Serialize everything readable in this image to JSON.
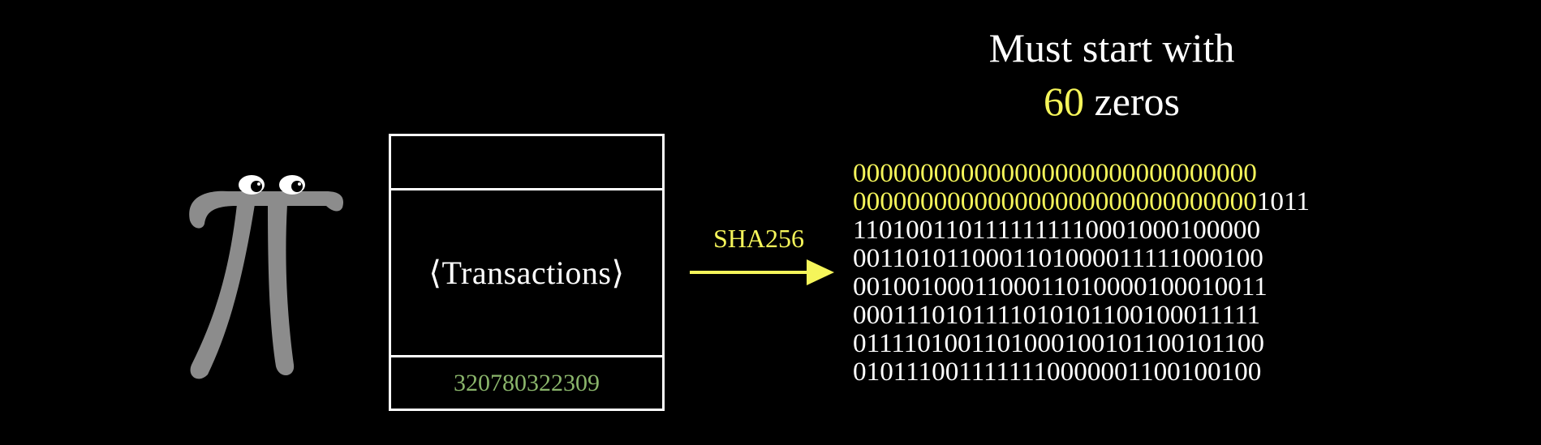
{
  "title": {
    "line1": "Must start with",
    "count": "60",
    "line2_rest": " zeros"
  },
  "block": {
    "body_text": "⟨Transactions⟩",
    "nonce": "320780322309"
  },
  "arrow": {
    "label": "SHA256"
  },
  "hash": {
    "lines": [
      {
        "zeros": "000000000000000000000000000000",
        "rest": ""
      },
      {
        "zeros": "000000000000000000000000000000",
        "rest": "1011"
      },
      {
        "zeros": "",
        "rest": "1101001101111111110001000100000"
      },
      {
        "zeros": "",
        "rest": "0011010110001101000011111000100"
      },
      {
        "zeros": "",
        "rest": "0010010001100011010000100010011"
      },
      {
        "zeros": "",
        "rest": "0001110101111010101100100011111"
      },
      {
        "zeros": "",
        "rest": "0111101001101000100101100101100"
      },
      {
        "zeros": "",
        "rest": "0101110011111110000001100100100"
      }
    ]
  },
  "colors": {
    "background": "#000000",
    "accent": "#f5f55a",
    "nonce": "#8ab56b",
    "pi_body": "#8c8c8c",
    "stroke": "#ffffff"
  },
  "icons": {
    "character": "pi-creature-icon",
    "arrow": "arrow-right-icon"
  }
}
